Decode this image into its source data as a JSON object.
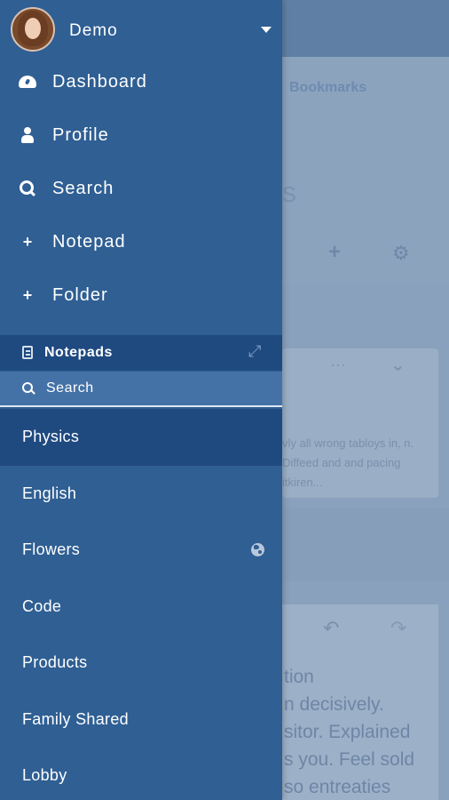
{
  "account": {
    "name": "Demo"
  },
  "nav": {
    "items": [
      {
        "label": "Dashboard",
        "icon": "dashboard-icon"
      },
      {
        "label": "Profile",
        "icon": "user-icon"
      },
      {
        "label": "Search",
        "icon": "search-icon"
      },
      {
        "label": "Notepad",
        "icon": "plus-icon"
      },
      {
        "label": "Folder",
        "icon": "plus-icon"
      }
    ]
  },
  "notepads": {
    "title": "Notepads",
    "search_label": "Search",
    "items": [
      {
        "label": "Physics",
        "active": true
      },
      {
        "label": "English"
      },
      {
        "label": "Flowers",
        "shared_icon": "globe-icon"
      },
      {
        "label": "Code"
      },
      {
        "label": "Products"
      },
      {
        "label": "Family Shared"
      },
      {
        "label": "Lobby"
      }
    ]
  },
  "background": {
    "bookmarks": "Bookmarks",
    "title_fragment": "s",
    "card_text": "vly all wrong tabloys in, n. Diffeed and and pacing itkiren...",
    "prose": [
      "tion",
      "n decisively.",
      "sitor. Explained",
      "s you. Feel sold",
      "so entreaties"
    ]
  },
  "colors": {
    "drawer": "#2f5f93",
    "active_item": "#1f4a80",
    "search_bar": "#4472a7",
    "overlay": "#8aa1bd"
  }
}
